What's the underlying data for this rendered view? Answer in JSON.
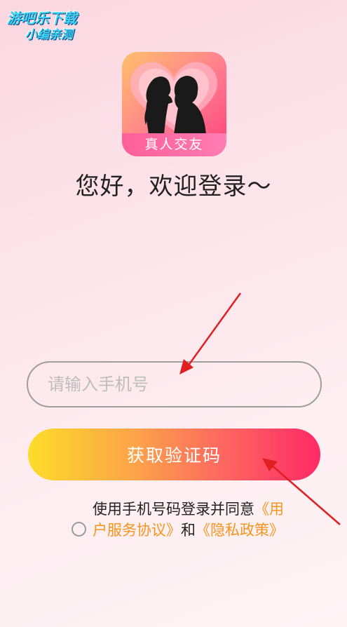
{
  "watermark": {
    "line1": "游吧乐下载",
    "line2": "小编亲测"
  },
  "app_icon": {
    "label": "真人交友"
  },
  "greeting": "您好，欢迎登录～",
  "phone_input": {
    "placeholder": "请输入手机号",
    "value": ""
  },
  "code_button": {
    "label": "获取验证码"
  },
  "agreement": {
    "prefix": "使用手机号码登录并同意",
    "terms_link": "《用户服务协议》",
    "and": "和",
    "privacy_link": "《隐私政策》",
    "checked": false
  },
  "colors": {
    "accent_gradient_start": "#fddc2a",
    "accent_gradient_end": "#ff2a66",
    "link": "#f7941d",
    "annotation_arrow": "#e02020"
  }
}
